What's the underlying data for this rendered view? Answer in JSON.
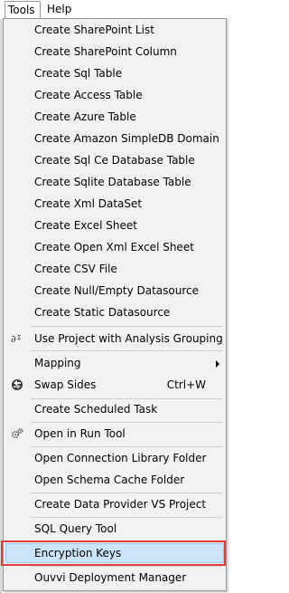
{
  "menubar": {
    "items": [
      {
        "label": "Tools",
        "active": true
      },
      {
        "label": "Help",
        "active": false
      }
    ]
  },
  "menu": {
    "items": [
      {
        "label": "Create SharePoint List"
      },
      {
        "label": "Create SharePoint Column"
      },
      {
        "label": "Create Sql Table"
      },
      {
        "label": "Create Access Table"
      },
      {
        "label": "Create Azure Table"
      },
      {
        "label": "Create Amazon SimpleDB Domain"
      },
      {
        "label": "Create Sql Ce Database Table"
      },
      {
        "label": "Create Sqlite Database Table"
      },
      {
        "label": "Create Xml DataSet"
      },
      {
        "label": "Create Excel Sheet"
      },
      {
        "label": "Create Open Xml Excel Sheet"
      },
      {
        "label": "Create CSV File"
      },
      {
        "label": "Create Null/Empty Datasource"
      },
      {
        "label": "Create Static Datasource"
      },
      {
        "label": "Use Project with Analysis Grouping",
        "icon": "analysis-grouping-icon"
      },
      {
        "label": "Mapping",
        "submenu": true
      },
      {
        "label": "Swap Sides",
        "shortcut": "Ctrl+W",
        "icon": "swap-sides-icon"
      },
      {
        "label": "Create Scheduled Task"
      },
      {
        "label": "Open in Run Tool",
        "icon": "run-tool-gears-icon"
      },
      {
        "label": "Open Connection Library Folder"
      },
      {
        "label": "Open Schema Cache Folder"
      },
      {
        "label": "Create Data Provider VS Project"
      },
      {
        "label": "SQL Query Tool"
      },
      {
        "label": "Encryption Keys",
        "highlighted": true
      },
      {
        "label": "Ouvvi Deployment Manager"
      }
    ]
  },
  "colors": {
    "menu_background": "#f2f2f2",
    "highlight_fill": "#cce4f7",
    "highlight_border": "#9cc6ea",
    "annotation_box": "#e53b3b"
  }
}
